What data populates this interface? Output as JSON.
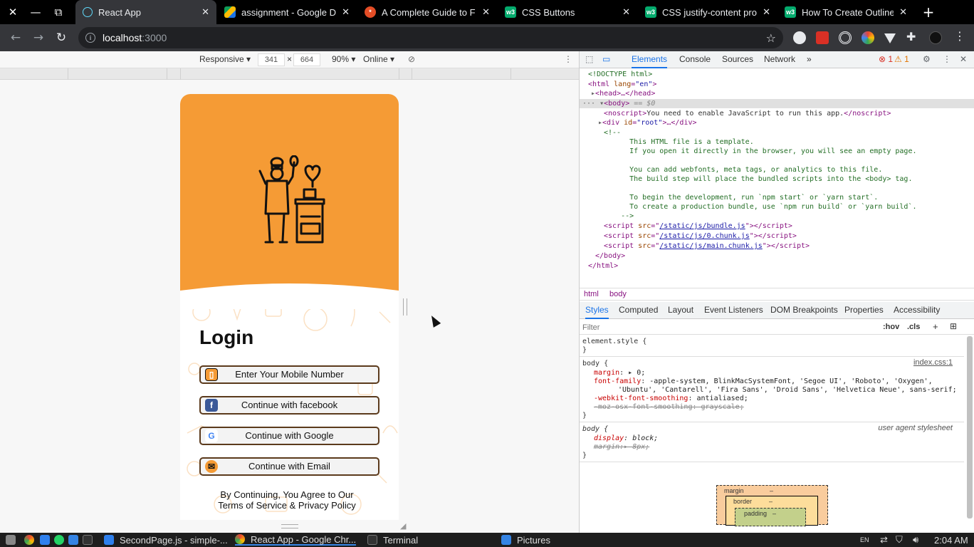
{
  "browser": {
    "window_controls": {
      "close": "✕",
      "minimize": "—",
      "restore": "⧉"
    },
    "tabs": [
      {
        "title": "React App",
        "favicon": "react",
        "color": "#61dafb",
        "active": true
      },
      {
        "title": "assignment - Google D",
        "favicon": "drive",
        "color": "#1a73e8",
        "active": false
      },
      {
        "title": "A Complete Guide to F",
        "favicon": "css-tricks",
        "color": "#e44d26",
        "active": false
      },
      {
        "title": "CSS Buttons",
        "favicon": "w3schools",
        "color": "#04aa6d",
        "active": false
      },
      {
        "title": "CSS justify-content pro",
        "favicon": "w3schools",
        "color": "#04aa6d",
        "active": false
      },
      {
        "title": "How To Create Outline",
        "favicon": "w3schools",
        "color": "#04aa6d",
        "active": false
      }
    ],
    "url": {
      "host": "localhost",
      "port": ":3000"
    }
  },
  "device_toolbar": {
    "mode": "Responsive",
    "width": "341",
    "times": "×",
    "height": "664",
    "zoom": "90%",
    "throttle": "Online"
  },
  "app": {
    "title": "Login",
    "buttons": [
      {
        "label": "Enter Your Mobile Number",
        "icon": "mobile-icon",
        "icon_glyph": "▯",
        "icon_bg": "#f59b35"
      },
      {
        "label": "Continue with facebook",
        "icon": "facebook-icon",
        "icon_glyph": "f",
        "icon_bg": "#3b5998"
      },
      {
        "label": "Continue with Google",
        "icon": "google-icon",
        "icon_glyph": "G",
        "icon_bg": "#ffffff"
      },
      {
        "label": "Continue with Email",
        "icon": "email-icon",
        "icon_glyph": "✉",
        "icon_bg": "#f59b35"
      }
    ],
    "terms_line1": "By Continuing, You Agree to Our",
    "terms_line2": "Terms of Service & Privacy Policy",
    "colors": {
      "brand": "#f59b35",
      "button_border": "#5b3a1c"
    }
  },
  "devtools": {
    "tabs": [
      "Elements",
      "Console",
      "Sources",
      "Network",
      "»"
    ],
    "errors": "1",
    "warnings": "1",
    "dom": {
      "doctype": "<!DOCTYPE html>",
      "html_open": "html",
      "lang_attr": "lang",
      "lang_val": "\"en\"",
      "head": "head",
      "body": "body",
      "body_suffix": " == $0",
      "noscript_text": "You need to enable JavaScript to run this app.",
      "root_id": "\"root\"",
      "comment": [
        "<!--",
        "      This HTML file is a template.",
        "      If you open it directly in the browser, you will see an empty page.",
        "",
        "      You can add webfonts, meta tags, or analytics to this file.",
        "      The build step will place the bundled scripts into the <body> tag.",
        "",
        "      To begin the development, run `npm start` or `yarn start`.",
        "      To create a production bundle, use `npm run build` or `yarn build`.",
        "    -->"
      ],
      "scripts": [
        "/static/js/bundle.js",
        "/static/js/0.chunk.js",
        "/static/js/main.chunk.js"
      ]
    },
    "breadcrumbs": [
      "html",
      "body"
    ],
    "panel_tabs": [
      "Styles",
      "Computed",
      "Layout",
      "Event Listeners",
      "DOM Breakpoints",
      "Properties",
      "Accessibility"
    ],
    "filter_placeholder": "Filter",
    "hov": ":hov",
    "cls": ".cls",
    "styles": {
      "element_style": "element.style {",
      "close": "}",
      "body_selector": "body {",
      "source": "index.css:1",
      "margin": "0;",
      "font_family_1": "-apple-system, BlinkMacSystemFont, 'Segoe UI', 'Roboto', 'Oxygen',",
      "font_family_2": "'Ubuntu', 'Cantarell', 'Fira Sans', 'Droid Sans', 'Helvetica Neue', sans-serif;",
      "smoothing": "antialiased;",
      "moz_smoothing": "-moz-osx-font-smoothing: grayscale;",
      "ua_source": "user agent stylesheet",
      "display": "block;",
      "ua_margin": "8px;"
    },
    "boxmodel": {
      "margin": "margin",
      "border": "border",
      "padding": "padding",
      "dash": "–"
    }
  },
  "taskbar": {
    "items": [
      {
        "label": "SecondPage.js - simple-...",
        "icon": "vscode-icon",
        "color": "#2f80ed"
      },
      {
        "label": "React App - Google Chr...",
        "icon": "chrome-icon",
        "color": "#fbbc04"
      },
      {
        "label": "Terminal",
        "icon": "terminal-icon",
        "color": "#444444"
      },
      {
        "label": "Pictures",
        "icon": "folder-icon",
        "color": "#3584e4"
      }
    ],
    "time": "2:04 AM",
    "lang": "EN"
  }
}
